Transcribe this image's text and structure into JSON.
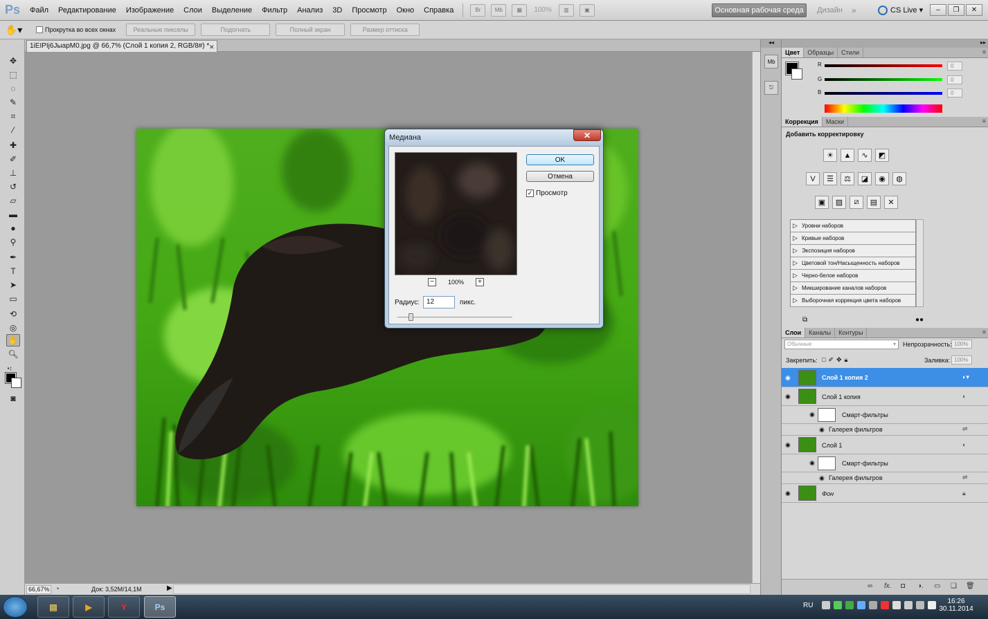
{
  "menubar": {
    "logo": "Ps",
    "items": [
      "Файл",
      "Редактирование",
      "Изображение",
      "Слои",
      "Выделение",
      "Фильтр",
      "Анализ",
      "3D",
      "Просмотр",
      "Окно",
      "Справка"
    ],
    "zoom": "100%",
    "workspace": "Основная рабочая среда",
    "design": "Дизайн",
    "cslive": "CS Live"
  },
  "optionsbar": {
    "scroll_all": "Прокрутка во всех окнах",
    "actual_pixels": "Реальные пикселы",
    "fit_screen": "Подогнать",
    "full_screen": "Полный экран",
    "print_size": "Размер оттиска"
  },
  "document": {
    "tab_title": "1iEIPIj6JыарM0.jpg @ 66,7% (Слой 1 копия 2, RGB/8#) *",
    "zoom": "66,67%",
    "doc_size": "Док: 3,52M/14,1M"
  },
  "dialog": {
    "title": "Медиана",
    "ok": "OK",
    "cancel": "Отмена",
    "preview": "Просмотр",
    "zoom": "100%",
    "radius_label": "Радиус:",
    "radius_value": "12",
    "radius_unit": "пикс."
  },
  "color_panel": {
    "tabs": [
      "Цвет",
      "Образцы",
      "Стили"
    ],
    "r_label": "R",
    "g_label": "G",
    "b_label": "B",
    "r": "0",
    "g": "0",
    "b": "0"
  },
  "adjustments_panel": {
    "tabs": [
      "Коррекция",
      "Маски"
    ],
    "title": "Добавить корректировку",
    "presets": [
      "Уровни наборов",
      "Кривые наборов",
      "Экспозиция наборов",
      "Цветовой тон/Насыщенность наборов",
      "Черно-белое наборов",
      "Микширование каналов наборов",
      "Выборочная коррекция цвета наборов"
    ]
  },
  "layers_panel": {
    "tabs": [
      "Слои",
      "Каналы",
      "Контуры"
    ],
    "blend_mode": "Обычные",
    "opacity_label": "Непрозрачность:",
    "opacity": "100%",
    "lock_label": "Закрепить:",
    "fill_label": "Заливка:",
    "fill": "100%",
    "layers": {
      "l1": "Слой 1 копия 2",
      "l2": "Слой 1 копия",
      "sf1": "Смарт-фильтры",
      "fg1": "Галерея фильтров",
      "l3": "Слой 1",
      "sf2": "Смарт-фильтры",
      "fg2": "Галерея фильтров",
      "bg": "Фон"
    }
  },
  "taskbar": {
    "lang": "RU",
    "time": "16:26",
    "date": "30.11.2014",
    "ps_label": "Ps"
  }
}
